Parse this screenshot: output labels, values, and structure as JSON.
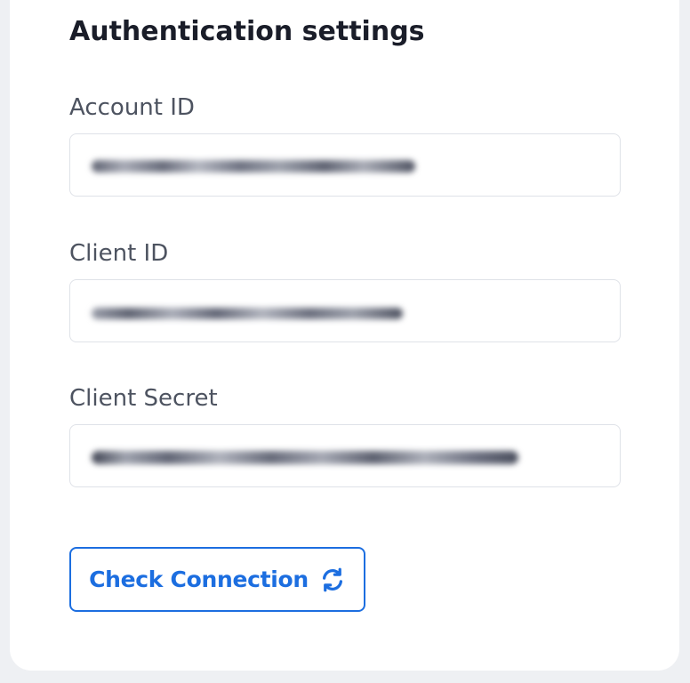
{
  "form": {
    "title": "Authentication settings",
    "fields": [
      {
        "label": "Account ID",
        "value": "",
        "obscured": true
      },
      {
        "label": "Client ID",
        "value": "",
        "obscured": true
      },
      {
        "label": "Client Secret",
        "value": "",
        "obscured": true
      }
    ]
  },
  "actions": {
    "check_connection_label": "Check Connection",
    "check_connection_icon": "refresh-icon"
  },
  "colors": {
    "accent": "#1c6ee0",
    "title_text": "#1a1d29",
    "label_text": "#4d5360",
    "input_border": "#dfe2e8",
    "card_bg": "#ffffff",
    "page_bg": "#eef0f3"
  }
}
